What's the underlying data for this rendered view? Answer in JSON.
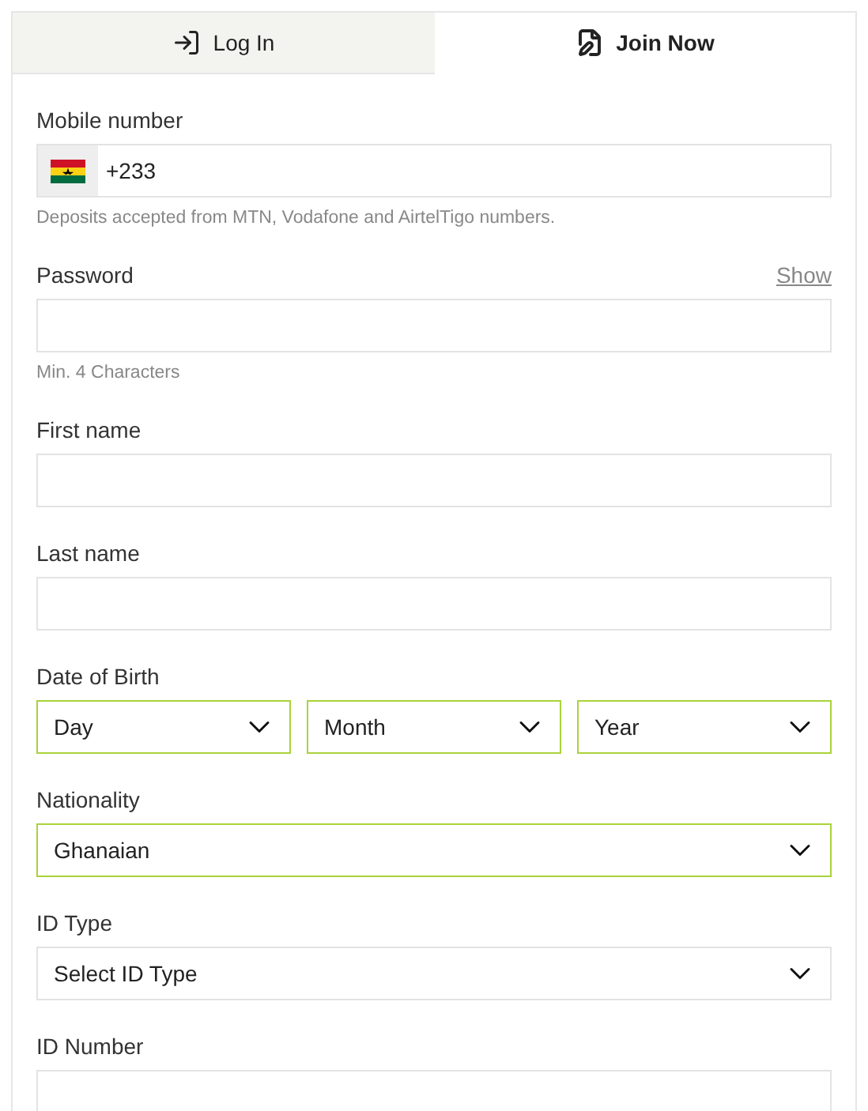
{
  "tabs": [
    {
      "label": "Log In",
      "selected": false,
      "kind": "login"
    },
    {
      "label": "Join Now",
      "selected": true,
      "kind": "join"
    }
  ],
  "fields": [
    {
      "kind": "phone",
      "label": "Mobile number",
      "value": "+233",
      "hint": "Deposits accepted from MTN, Vodafone and AirtelTigo numbers."
    },
    {
      "kind": "password",
      "label": "Password",
      "toggle": "Show",
      "hint": "Min. 4 Characters"
    },
    {
      "kind": "text",
      "label": "First name"
    },
    {
      "kind": "text",
      "label": "Last name"
    },
    {
      "kind": "selects",
      "label": "Date of Birth",
      "options": [
        {
          "value": "Day",
          "highlighted": true
        },
        {
          "value": "Month",
          "highlighted": true
        },
        {
          "value": "Year",
          "highlighted": true
        }
      ]
    },
    {
      "kind": "select",
      "label": "Nationality",
      "value": "Ghanaian",
      "highlighted": true
    },
    {
      "kind": "select",
      "label": "ID Type",
      "value": "Select ID Type",
      "highlighted": false
    },
    {
      "kind": "text",
      "label": "ID Number"
    }
  ]
}
